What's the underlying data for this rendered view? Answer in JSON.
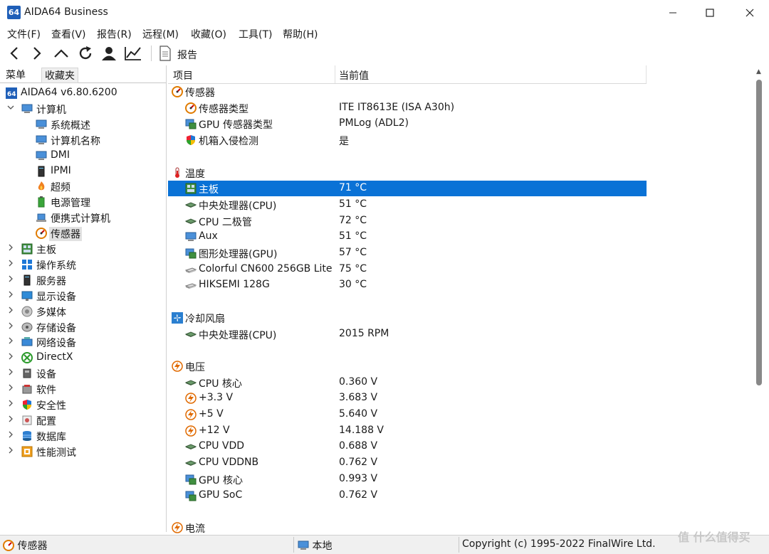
{
  "window": {
    "logo": "64",
    "title": "AIDA64 Business"
  },
  "menu": [
    "文件(F)",
    "查看(V)",
    "报告(R)",
    "远程(M)",
    "收藏(O)",
    "工具(T)",
    "帮助(H)"
  ],
  "toolbar": {
    "report_label": "报告"
  },
  "left_tabs": [
    "菜单",
    "收藏夹"
  ],
  "tree": [
    {
      "label": "AIDA64 v6.80.6200",
      "icon": "aida64-logo-icon"
    },
    {
      "label": "计算机",
      "icon": "computer-icon"
    },
    {
      "label": "系统概述",
      "icon": "computer-icon"
    },
    {
      "label": "计算机名称",
      "icon": "computer-icon"
    },
    {
      "label": "DMI",
      "icon": "computer-icon"
    },
    {
      "label": "IPMI",
      "icon": "server-icon"
    },
    {
      "label": "超频",
      "icon": "flame-icon"
    },
    {
      "label": "电源管理",
      "icon": "battery-icon"
    },
    {
      "label": "便携式计算机",
      "icon": "laptop-icon"
    },
    {
      "label": "传感器",
      "icon": "gauge-icon"
    },
    {
      "label": "主板",
      "icon": "motherboard-icon"
    },
    {
      "label": "操作系统",
      "icon": "windows-icon"
    },
    {
      "label": "服务器",
      "icon": "server-icon"
    },
    {
      "label": "显示设备",
      "icon": "monitor-icon"
    },
    {
      "label": "多媒体",
      "icon": "speaker-icon"
    },
    {
      "label": "存储设备",
      "icon": "disk-icon"
    },
    {
      "label": "网络设备",
      "icon": "network-icon"
    },
    {
      "label": "DirectX",
      "icon": "xbox-icon"
    },
    {
      "label": "设备",
      "icon": "device-icon"
    },
    {
      "label": "软件",
      "icon": "software-icon"
    },
    {
      "label": "安全性",
      "icon": "shield-icon"
    },
    {
      "label": "配置",
      "icon": "config-icon"
    },
    {
      "label": "数据库",
      "icon": "database-icon"
    },
    {
      "label": "性能测试",
      "icon": "benchmark-icon"
    }
  ],
  "columns": {
    "item": "项目",
    "value": "当前值"
  },
  "sections": [
    {
      "title": "传感器",
      "icon": "gauge-icon",
      "rows": [
        {
          "name": "传感器类型",
          "value": "ITE IT8613E  (ISA A30h)",
          "icon": "gauge-icon"
        },
        {
          "name": "GPU 传感器类型",
          "value": "PMLog  (ADL2)",
          "icon": "gpu-icon"
        },
        {
          "name": "机箱入侵检测",
          "value": "是",
          "icon": "shield-icon"
        }
      ]
    },
    {
      "title": "温度",
      "icon": "thermometer-icon",
      "rows": [
        {
          "name": "主板",
          "value": "71 °C",
          "icon": "motherboard-icon"
        },
        {
          "name": "中央处理器(CPU)",
          "value": "51 °C",
          "icon": "cpu-icon"
        },
        {
          "name": "CPU 二极管",
          "value": "72 °C",
          "icon": "cpu-icon"
        },
        {
          "name": "Aux",
          "value": "51 °C",
          "icon": "computer-icon"
        },
        {
          "name": "图形处理器(GPU)",
          "value": "57 °C",
          "icon": "gpu-icon"
        },
        {
          "name": "Colorful CN600 256GB Lite",
          "value": "75 °C",
          "icon": "drive-icon"
        },
        {
          "name": "HIKSEMI 128G",
          "value": "30 °C",
          "icon": "drive-icon"
        }
      ]
    },
    {
      "title": "冷却风扇",
      "icon": "fan-icon",
      "rows": [
        {
          "name": "中央处理器(CPU)",
          "value": "2015 RPM",
          "icon": "cpu-icon"
        }
      ]
    },
    {
      "title": "电压",
      "icon": "bolt-icon",
      "rows": [
        {
          "name": "CPU 核心",
          "value": "0.360 V",
          "icon": "cpu-icon"
        },
        {
          "name": "+3.3 V",
          "value": "3.683 V",
          "icon": "bolt-icon"
        },
        {
          "name": "+5 V",
          "value": "5.640 V",
          "icon": "bolt-icon"
        },
        {
          "name": "+12 V",
          "value": "14.188 V",
          "icon": "bolt-icon"
        },
        {
          "name": "CPU VDD",
          "value": "0.688 V",
          "icon": "cpu-icon"
        },
        {
          "name": "CPU VDDNB",
          "value": "0.762 V",
          "icon": "cpu-icon"
        },
        {
          "name": "GPU 核心",
          "value": "0.993 V",
          "icon": "gpu-icon"
        },
        {
          "name": "GPU SoC",
          "value": "0.762 V",
          "icon": "gpu-icon"
        }
      ]
    },
    {
      "title": "电流",
      "icon": "bolt-icon",
      "rows": []
    }
  ],
  "status": {
    "left": "传感器",
    "middle": "本地",
    "right": "Copyright (c) 1995-2022 FinalWire Ltd.",
    "watermark": "值 什么值得买"
  }
}
